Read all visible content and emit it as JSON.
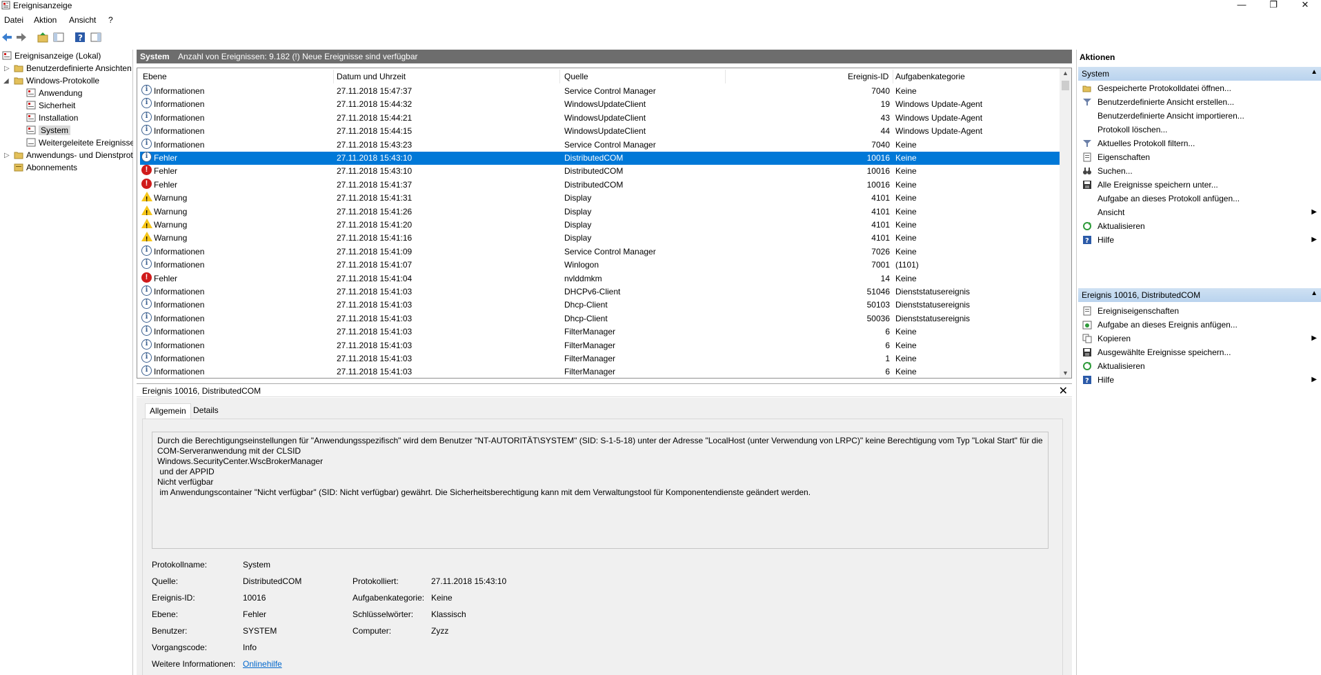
{
  "window": {
    "title": "Ereignisanzeige"
  },
  "menu": [
    "Datei",
    "Aktion",
    "Ansicht",
    "?"
  ],
  "tree": {
    "root": "Ereignisanzeige (Lokal)",
    "custom_views": "Benutzerdefinierte Ansichten",
    "windows_logs": "Windows-Protokolle",
    "logs": [
      "Anwendung",
      "Sicherheit",
      "Installation",
      "System",
      "Weitergeleitete Ereignisse"
    ],
    "app_services": "Anwendungs- und Dienstprotokolle",
    "subscriptions": "Abonnements"
  },
  "center": {
    "log_name": "System",
    "summary": "Anzahl von Ereignissen: 9.182 (!) Neue Ereignisse sind verfügbar"
  },
  "grid": {
    "columns": [
      "Ebene",
      "Datum und Uhrzeit",
      "Quelle",
      "Ereignis-ID",
      "Aufgabenkategorie"
    ],
    "selected_index": 5,
    "rows": [
      {
        "level": "Informationen",
        "icon": "info",
        "date": "27.11.2018 15:47:37",
        "source": "Service Control Manager",
        "id": "7040",
        "cat": "Keine"
      },
      {
        "level": "Informationen",
        "icon": "info",
        "date": "27.11.2018 15:44:32",
        "source": "WindowsUpdateClient",
        "id": "19",
        "cat": "Windows Update-Agent"
      },
      {
        "level": "Informationen",
        "icon": "info",
        "date": "27.11.2018 15:44:21",
        "source": "WindowsUpdateClient",
        "id": "43",
        "cat": "Windows Update-Agent"
      },
      {
        "level": "Informationen",
        "icon": "info",
        "date": "27.11.2018 15:44:15",
        "source": "WindowsUpdateClient",
        "id": "44",
        "cat": "Windows Update-Agent"
      },
      {
        "level": "Informationen",
        "icon": "info",
        "date": "27.11.2018 15:43:23",
        "source": "Service Control Manager",
        "id": "7040",
        "cat": "Keine"
      },
      {
        "level": "Fehler",
        "icon": "info",
        "date": "27.11.2018 15:43:10",
        "source": "DistributedCOM",
        "id": "10016",
        "cat": "Keine"
      },
      {
        "level": "Fehler",
        "icon": "err",
        "date": "27.11.2018 15:43:10",
        "source": "DistributedCOM",
        "id": "10016",
        "cat": "Keine"
      },
      {
        "level": "Fehler",
        "icon": "err",
        "date": "27.11.2018 15:41:37",
        "source": "DistributedCOM",
        "id": "10016",
        "cat": "Keine"
      },
      {
        "level": "Warnung",
        "icon": "warn",
        "date": "27.11.2018 15:41:31",
        "source": "Display",
        "id": "4101",
        "cat": "Keine"
      },
      {
        "level": "Warnung",
        "icon": "warn",
        "date": "27.11.2018 15:41:26",
        "source": "Display",
        "id": "4101",
        "cat": "Keine"
      },
      {
        "level": "Warnung",
        "icon": "warn",
        "date": "27.11.2018 15:41:20",
        "source": "Display",
        "id": "4101",
        "cat": "Keine"
      },
      {
        "level": "Warnung",
        "icon": "warn",
        "date": "27.11.2018 15:41:16",
        "source": "Display",
        "id": "4101",
        "cat": "Keine"
      },
      {
        "level": "Informationen",
        "icon": "info",
        "date": "27.11.2018 15:41:09",
        "source": "Service Control Manager",
        "id": "7026",
        "cat": "Keine"
      },
      {
        "level": "Informationen",
        "icon": "info",
        "date": "27.11.2018 15:41:07",
        "source": "Winlogon",
        "id": "7001",
        "cat": "(1101)"
      },
      {
        "level": "Fehler",
        "icon": "err",
        "date": "27.11.2018 15:41:04",
        "source": "nvlddmkm",
        "id": "14",
        "cat": "Keine"
      },
      {
        "level": "Informationen",
        "icon": "info",
        "date": "27.11.2018 15:41:03",
        "source": "DHCPv6-Client",
        "id": "51046",
        "cat": "Dienststatusereignis"
      },
      {
        "level": "Informationen",
        "icon": "info",
        "date": "27.11.2018 15:41:03",
        "source": "Dhcp-Client",
        "id": "50103",
        "cat": "Dienststatusereignis"
      },
      {
        "level": "Informationen",
        "icon": "info",
        "date": "27.11.2018 15:41:03",
        "source": "Dhcp-Client",
        "id": "50036",
        "cat": "Dienststatusereignis"
      },
      {
        "level": "Informationen",
        "icon": "info",
        "date": "27.11.2018 15:41:03",
        "source": "FilterManager",
        "id": "6",
        "cat": "Keine"
      },
      {
        "level": "Informationen",
        "icon": "info",
        "date": "27.11.2018 15:41:03",
        "source": "FilterManager",
        "id": "6",
        "cat": "Keine"
      },
      {
        "level": "Informationen",
        "icon": "info",
        "date": "27.11.2018 15:41:03",
        "source": "FilterManager",
        "id": "1",
        "cat": "Keine"
      },
      {
        "level": "Informationen",
        "icon": "info",
        "date": "27.11.2018 15:41:03",
        "source": "FilterManager",
        "id": "6",
        "cat": "Keine"
      }
    ]
  },
  "details": {
    "header": "Ereignis 10016, DistributedCOM",
    "tabs": [
      "Allgemein",
      "Details"
    ],
    "description": "Durch die Berechtigungseinstellungen für \"Anwendungsspezifisch\" wird dem Benutzer \"NT-AUTORITÄT\\SYSTEM\" (SID: S-1-5-18) unter der Adresse \"LocalHost (unter Verwendung von LRPC)\" keine Berechtigung vom Typ \"Lokal Start\" für die\nCOM-Serveranwendung mit der CLSID\nWindows.SecurityCenter.WscBrokerManager\n und der APPID\nNicht verfügbar\n im Anwendungscontainer \"Nicht verfügbar\" (SID: Nicht verfügbar) gewährt. Die Sicherheitsberechtigung kann mit dem Verwaltungstool für Komponentendienste geändert werden.",
    "props": {
      "log_label": "Protokollname:",
      "log_value": "System",
      "source_label": "Quelle:",
      "source_value": "DistributedCOM",
      "logged_label": "Protokolliert:",
      "logged_value": "27.11.2018 15:43:10",
      "id_label": "Ereignis-ID:",
      "id_value": "10016",
      "cat_label": "Aufgabenkategorie:",
      "cat_value": "Keine",
      "level_label": "Ebene:",
      "level_value": "Fehler",
      "keywords_label": "Schlüsselwörter:",
      "keywords_value": "Klassisch",
      "user_label": "Benutzer:",
      "user_value": "SYSTEM",
      "computer_label": "Computer:",
      "computer_value": "Zyzz",
      "opcode_label": "Vorgangscode:",
      "opcode_value": "Info",
      "more_label": "Weitere Informationen:",
      "more_link": "Onlinehilfe"
    }
  },
  "actions": {
    "title": "Aktionen",
    "group1": "System",
    "items1": [
      {
        "label": "Gespeicherte Protokolldatei öffnen...",
        "icon": "open-folder-icon"
      },
      {
        "label": "Benutzerdefinierte Ansicht erstellen...",
        "icon": "filter-icon"
      },
      {
        "label": "Benutzerdefinierte Ansicht importieren...",
        "icon": ""
      },
      {
        "label": "Protokoll löschen...",
        "icon": ""
      },
      {
        "label": "Aktuelles Protokoll filtern...",
        "icon": "filter-icon"
      },
      {
        "label": "Eigenschaften",
        "icon": "properties-icon"
      },
      {
        "label": "Suchen...",
        "icon": "binoculars-icon"
      },
      {
        "label": "Alle Ereignisse speichern unter...",
        "icon": "save-icon"
      },
      {
        "label": "Aufgabe an dieses Protokoll anfügen...",
        "icon": ""
      },
      {
        "label": "Ansicht",
        "icon": "",
        "submenu": true
      },
      {
        "label": "Aktualisieren",
        "icon": "refresh-icon"
      },
      {
        "label": "Hilfe",
        "icon": "help-icon",
        "submenu": true
      }
    ],
    "group2": "Ereignis 10016, DistributedCOM",
    "items2": [
      {
        "label": "Ereigniseigenschaften",
        "icon": "properties-icon"
      },
      {
        "label": "Aufgabe an dieses Ereignis anfügen...",
        "icon": "task-icon"
      },
      {
        "label": "Kopieren",
        "icon": "copy-icon",
        "submenu": true
      },
      {
        "label": "Ausgewählte Ereignisse speichern...",
        "icon": "save-icon"
      },
      {
        "label": "Aktualisieren",
        "icon": "refresh-icon"
      },
      {
        "label": "Hilfe",
        "icon": "help-icon",
        "submenu": true
      }
    ]
  }
}
